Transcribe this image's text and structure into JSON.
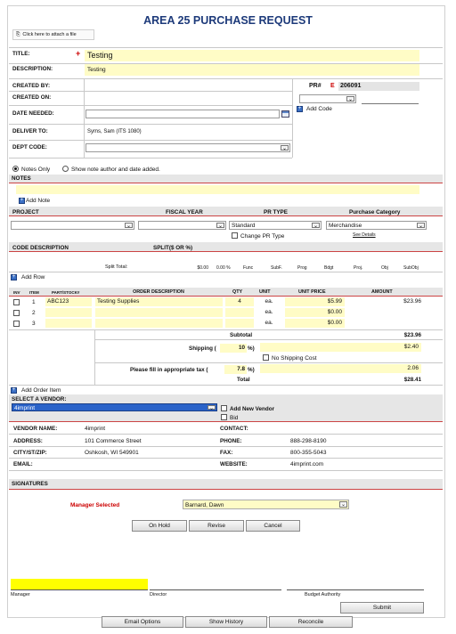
{
  "title": "AREA 25 PURCHASE REQUEST",
  "attach": {
    "label": "Click here to attach a file"
  },
  "fields": {
    "title_label": "TITLE:",
    "title_value": "Testing",
    "description_label": "DESCRIPTION:",
    "description_value": "Testing",
    "created_by_label": "CREATED BY:",
    "created_on_label": "CREATED ON:",
    "date_needed_label": "DATE NEEDED:",
    "deliver_to_label": "DELIVER TO:",
    "deliver_to_value": "Syms, Sam (ITS 1080)",
    "dept_code_label": "DEPT CODE:",
    "pr_label": "PR#",
    "pr_prefix": "E",
    "pr_number": "206091",
    "add_code": "Add Code",
    "required_mark": "+"
  },
  "notes": {
    "option_only": "Notes Only",
    "option_author": "Show note author and date added.",
    "header": "NOTES",
    "add_note": "Add Note"
  },
  "project_table": {
    "headers": [
      "PROJECT",
      "FISCAL YEAR",
      "PR TYPE",
      "Purchase Category"
    ],
    "pr_type_value": "Standard",
    "category_value": "Merchandise",
    "change_pr_type": "Change PR Type",
    "see_details": "See Details"
  },
  "split": {
    "headers": [
      "CODE DESCRIPTION",
      "SPLIT($ OR %)"
    ],
    "total_label": "Split Total:",
    "cols": [
      "$0.00",
      "0.00 %",
      "Func",
      "SubF.",
      "Prog",
      "Bdgt",
      "Proj.",
      "Obj",
      "SubObj"
    ],
    "add_row": "Add Row"
  },
  "items": {
    "headers": [
      "INV",
      "ITEM",
      "PART/STOCK#",
      "ORDER DESCRIPTION",
      "QTY",
      "UNIT",
      "UNIT PRICE",
      "AMOUNT"
    ],
    "rows": [
      {
        "num": "1",
        "part": "ABC123",
        "desc": "Testing Supplies",
        "qty": "4",
        "unit": "ea.",
        "price": "$5.99",
        "amount": "$23.96"
      },
      {
        "num": "2",
        "part": "",
        "desc": "",
        "qty": "",
        "unit": "ea.",
        "price": "$0.00",
        "amount": ""
      },
      {
        "num": "3",
        "part": "",
        "desc": "",
        "qty": "",
        "unit": "ea.",
        "price": "$0.00",
        "amount": ""
      }
    ],
    "subtotal_label": "Subtotal",
    "subtotal_value": "$23.96",
    "shipping_label": "Shipping (",
    "shipping_pct": "10",
    "pct_close": "%)",
    "shipping_value": "$2.40",
    "no_shipping": "No Shipping Cost",
    "tax_label": "Please fill in appropriate tax (",
    "tax_pct": "7.8",
    "tax_value": "2.06",
    "total_label": "Total",
    "total_value": "$28.41",
    "add_order_item": "Add Order Item"
  },
  "vendor": {
    "header": "SELECT A VENDOR:",
    "selected": "4imprint",
    "add_new": "Add New Vendor",
    "bid": "Bid",
    "name_label": "VENDOR NAME:",
    "name_value": "4imprint",
    "contact_label": "CONTACT:",
    "contact_value": "",
    "address_label": "ADDRESS:",
    "address_value": "101 Commerce Street",
    "phone_label": "PHONE:",
    "phone_value": "888-298-8190",
    "city_label": "CITY/ST/ZIP:",
    "city_value": "Oshkosh, WI 549901",
    "fax_label": "FAX:",
    "fax_value": "800-355-5043",
    "email_label": "EMAIL:",
    "email_value": "",
    "website_label": "WEBSITE:",
    "website_value": "4imprint.com"
  },
  "signatures": {
    "header": "SIGNATURES",
    "manager_selected": "Manager Selected",
    "manager_value": "Barnard, Dawn",
    "on_hold": "On Hold",
    "revise": "Revise",
    "cancel": "Cancel",
    "sig_manager": "Manager",
    "sig_director": "Director",
    "sig_budget": "Budget Authority",
    "submit": "Submit"
  },
  "footer": {
    "email_options": "Email Options",
    "show_history": "Show History",
    "reconcile": "Reconcile"
  },
  "colors": {
    "title": "#1d3a7a",
    "highlight": "#fffcc6",
    "signature_yellow": "#ffff00",
    "required": "#cc0000",
    "vendor_select": "#2a63c9"
  }
}
